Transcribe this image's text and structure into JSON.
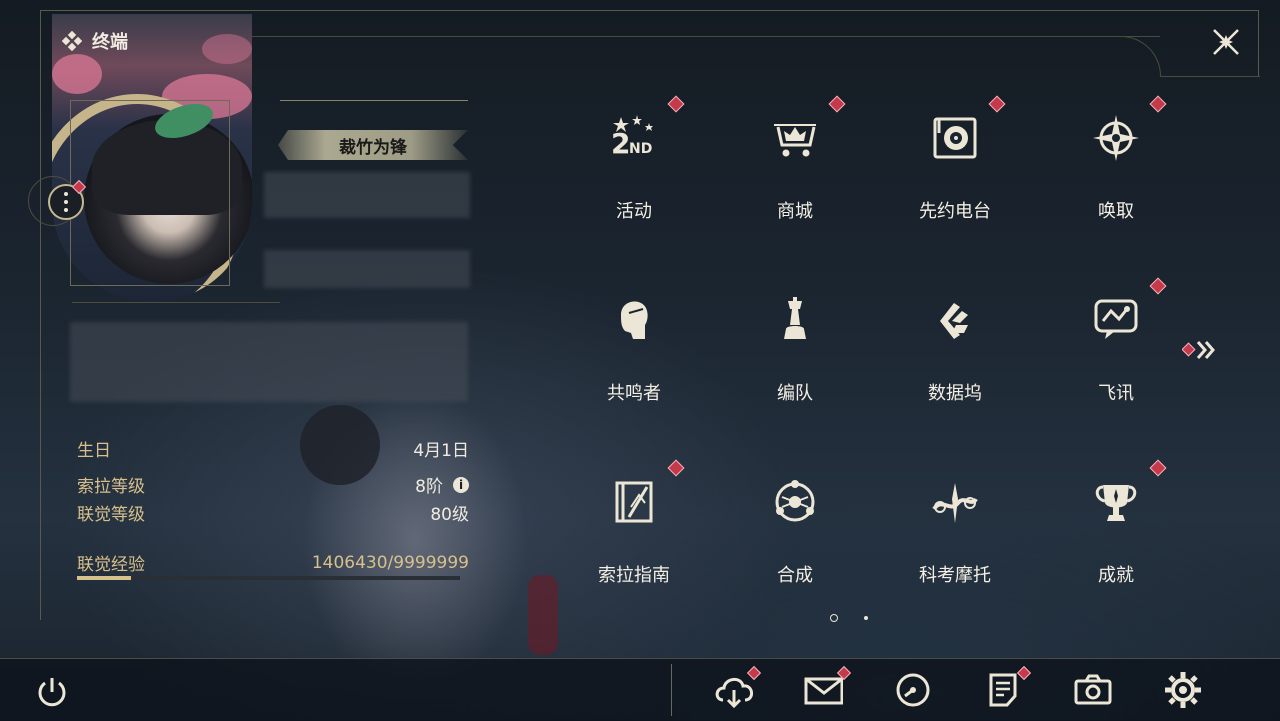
{
  "header": {
    "title": "终端"
  },
  "profile": {
    "title_badge": "裁竹为锋",
    "info": [
      {
        "label": "生日",
        "value": "4月1日"
      },
      {
        "label": "索拉等级",
        "value": "8阶"
      },
      {
        "label": "联觉等级",
        "value": "80级"
      },
      {
        "label": "联觉经验",
        "value": "1406430/9999999"
      }
    ],
    "exp_progress": 0.1406
  },
  "menu": {
    "rows": [
      [
        {
          "label": "活动",
          "icon": "activity-2nd-anniversary-icon",
          "badge": true
        },
        {
          "label": "商城",
          "icon": "shop-crown-cart-icon",
          "badge": true
        },
        {
          "label": "先约电台",
          "icon": "radio-turntable-icon",
          "badge": true
        },
        {
          "label": "唤取",
          "icon": "summon-compass-star-icon",
          "badge": true
        }
      ],
      [
        {
          "label": "共鸣者",
          "icon": "resonator-portrait-icon",
          "badge": false
        },
        {
          "label": "编队",
          "icon": "team-chess-icon",
          "badge": false
        },
        {
          "label": "数据坞",
          "icon": "data-bank-icon",
          "badge": false
        },
        {
          "label": "飞讯",
          "icon": "message-chat-icon",
          "badge": true
        }
      ],
      [
        {
          "label": "索拉指南",
          "icon": "guide-book-icon",
          "badge": true
        },
        {
          "label": "合成",
          "icon": "synthesis-circle-icon",
          "badge": false
        },
        {
          "label": "科考摩托",
          "icon": "motorbike-icon",
          "badge": false
        },
        {
          "label": "成就",
          "icon": "achievement-trophy-icon",
          "badge": true
        }
      ]
    ],
    "page_count": 2,
    "current_page": 1
  },
  "bottom_bar": {
    "buttons": [
      {
        "name": "download",
        "icon": "cloud-download-icon",
        "badge": true
      },
      {
        "name": "mail",
        "icon": "mail-envelope-icon",
        "badge": true
      },
      {
        "name": "clock",
        "icon": "clock-icon",
        "badge": false
      },
      {
        "name": "notes",
        "icon": "notice-document-icon",
        "badge": true
      },
      {
        "name": "camera",
        "icon": "camera-icon",
        "badge": false
      },
      {
        "name": "settings",
        "icon": "settings-gear-icon",
        "badge": false
      }
    ]
  },
  "colors": {
    "accent_gold": "#d7c08c",
    "badge_red": "#c53a4a",
    "text_light": "#f4efe4"
  }
}
